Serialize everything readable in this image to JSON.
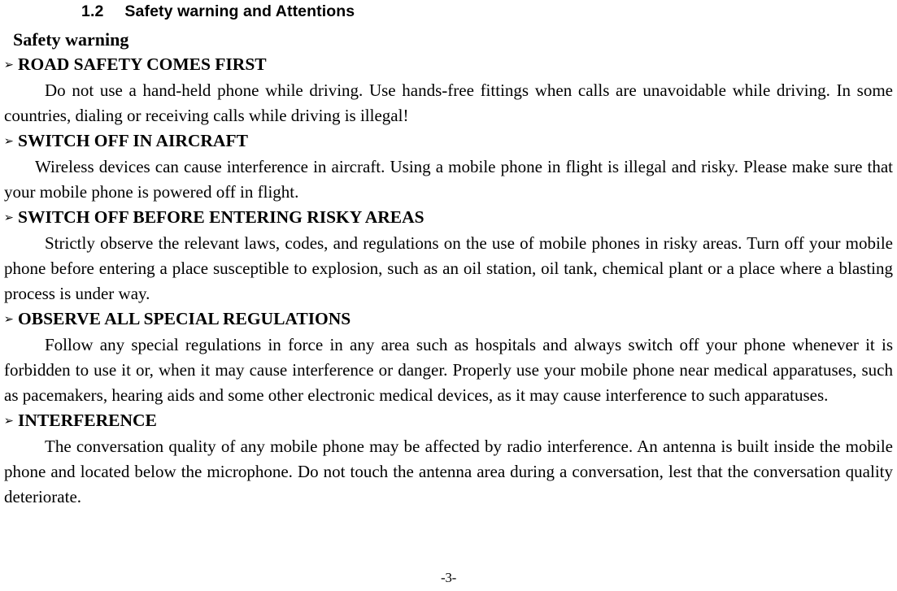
{
  "document": {
    "section_number": "1.2",
    "section_title": "Safety warning and Attentions",
    "sub_heading": "Safety warning",
    "bullet_glyph": "➢",
    "page_number": "-3-",
    "sections": [
      {
        "heading": "ROAD SAFETY COMES FIRST",
        "body": "Do not use a hand-held phone while driving. Use hands-free fittings when calls are unavoidable while driving. In some countries, dialing or receiving calls while driving is illegal!"
      },
      {
        "heading": "SWITCH OFF IN AIRCRAFT",
        "body": "Wireless devices can cause interference in aircraft. Using a mobile phone in flight is illegal and risky. Please make sure that your mobile phone is powered off in flight."
      },
      {
        "heading": "SWITCH OFF BEFORE ENTERING RISKY AREAS",
        "body": "Strictly observe the relevant laws, codes, and regulations on the use of mobile phones in risky areas. Turn off your mobile phone before entering a place susceptible to explosion, such as an oil station, oil tank, chemical plant or a place where a blasting process is under way."
      },
      {
        "heading": "OBSERVE ALL SPECIAL REGULATIONS",
        "body": "Follow any special regulations in force in any area such as hospitals and always switch off your phone whenever it is forbidden to use it or, when it may cause interference or danger. Properly use your mobile phone near medical apparatuses, such as pacemakers, hearing aids and some other electronic medical devices, as it may cause interference to such apparatuses."
      },
      {
        "heading": "INTERFERENCE",
        "body": "The conversation quality of any mobile phone may be affected by radio interference. An antenna is built inside the mobile phone and located below the microphone. Do not touch the antenna area during a conversation, lest that the conversation quality deteriorate."
      }
    ]
  }
}
